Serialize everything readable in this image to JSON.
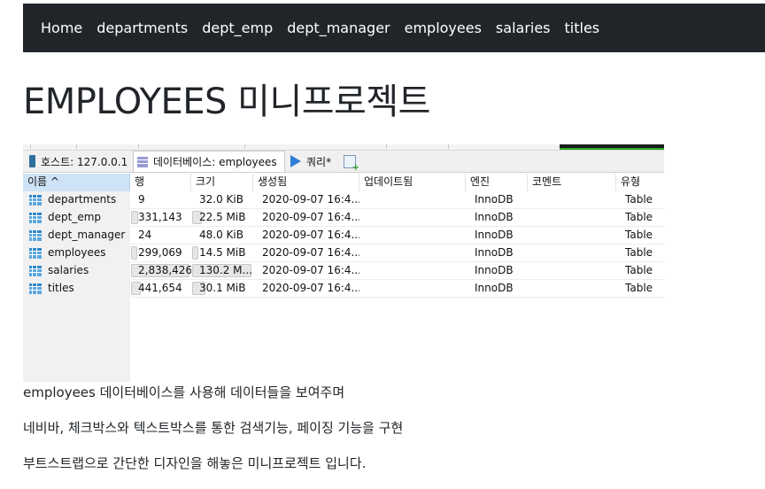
{
  "nav": {
    "items": [
      "Home",
      "departments",
      "dept_emp",
      "dept_manager",
      "employees",
      "salaries",
      "titles"
    ]
  },
  "page": {
    "title": "EMPLOYEES 미니프로젝트"
  },
  "screenshot": {
    "tabs": {
      "host": "호스트: 127.0.0.1",
      "database": "데이터베이스: employees",
      "query": "쿼리*"
    },
    "columns": {
      "name": "이름 ^",
      "rows": "행",
      "size": "크기",
      "created": "생성됨",
      "updated": "업데이트됨",
      "engine": "엔진",
      "comment": "코멘트",
      "type": "유형"
    },
    "tables": [
      {
        "name": "departments",
        "rows": "9",
        "size": "32.0 KiB",
        "created": "2020-09-07 16:4...",
        "engine": "InnoDB",
        "type": "Table",
        "rows_fill": 0.0,
        "size_fill": 0.0
      },
      {
        "name": "dept_emp",
        "rows": "331,143",
        "size": "22.5 MiB",
        "created": "2020-09-07 16:4...",
        "engine": "InnoDB",
        "type": "Table",
        "rows_fill": 0.12,
        "size_fill": 0.17
      },
      {
        "name": "dept_manager",
        "rows": "24",
        "size": "48.0 KiB",
        "created": "2020-09-07 16:4...",
        "engine": "InnoDB",
        "type": "Table",
        "rows_fill": 0.0,
        "size_fill": 0.0
      },
      {
        "name": "employees",
        "rows": "299,069",
        "size": "14.5 MiB",
        "created": "2020-09-07 16:4...",
        "engine": "InnoDB",
        "type": "Table",
        "rows_fill": 0.11,
        "size_fill": 0.11
      },
      {
        "name": "salaries",
        "rows": "2,838,426",
        "size": "130.2 M...",
        "created": "2020-09-07 16:4...",
        "engine": "InnoDB",
        "type": "Table",
        "rows_fill": 1.0,
        "size_fill": 1.0
      },
      {
        "name": "titles",
        "rows": "441,654",
        "size": "30.1 MiB",
        "created": "2020-09-07 16:4...",
        "engine": "InnoDB",
        "type": "Table",
        "rows_fill": 0.16,
        "size_fill": 0.23
      }
    ]
  },
  "description": [
    "employees 데이터베이스를 사용해 데이터들을 보여주며",
    "네비바, 체크박스와 텍스트박스를 통한 검색기능, 페이징 기능을 구현",
    "부트스트랩으로 간단한 디자인을 해놓은 미니프로젝트 입니다."
  ],
  "colors": {
    "navbar_bg": "#212529",
    "selected_header": "#cfe3f7"
  }
}
